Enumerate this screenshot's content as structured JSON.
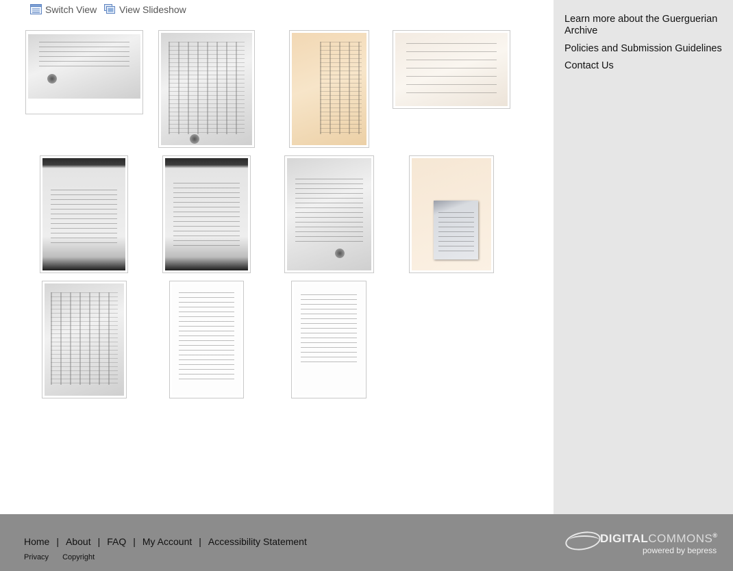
{
  "toolbar": {
    "switch_view": {
      "label": "Switch View",
      "icon": "list-view-icon"
    },
    "view_slideshow": {
      "label": "View Slideshow",
      "icon": "slideshow-icon"
    }
  },
  "thumbnails": [
    {
      "kind": "gray"
    },
    {
      "kind": "gray-columns"
    },
    {
      "kind": "tan-columns"
    },
    {
      "kind": "cream"
    },
    {
      "kind": "dark"
    },
    {
      "kind": "dark"
    },
    {
      "kind": "gray"
    },
    {
      "kind": "photo"
    },
    {
      "kind": "gray-columns"
    },
    {
      "kind": "white"
    },
    {
      "kind": "white"
    }
  ],
  "sidebar": {
    "links": [
      {
        "label": "Learn more about the Guerguerian Archive"
      },
      {
        "label": "Policies and Submission Guidelines"
      },
      {
        "label": "Contact Us"
      }
    ]
  },
  "footer": {
    "nav": [
      "Home",
      "About",
      "FAQ",
      "My Account",
      "Accessibility Statement"
    ],
    "nav_separator": "|",
    "sub": [
      "Privacy",
      "Copyright"
    ],
    "brand": {
      "strong": "DIGITAL",
      "light": "COMMONS",
      "mark": "®",
      "tagline": "powered by bepress"
    }
  },
  "colors": {
    "sidebar_bg": "#e6e6e6",
    "footer_bg": "#8c8c8c",
    "link_gray": "#555555"
  }
}
